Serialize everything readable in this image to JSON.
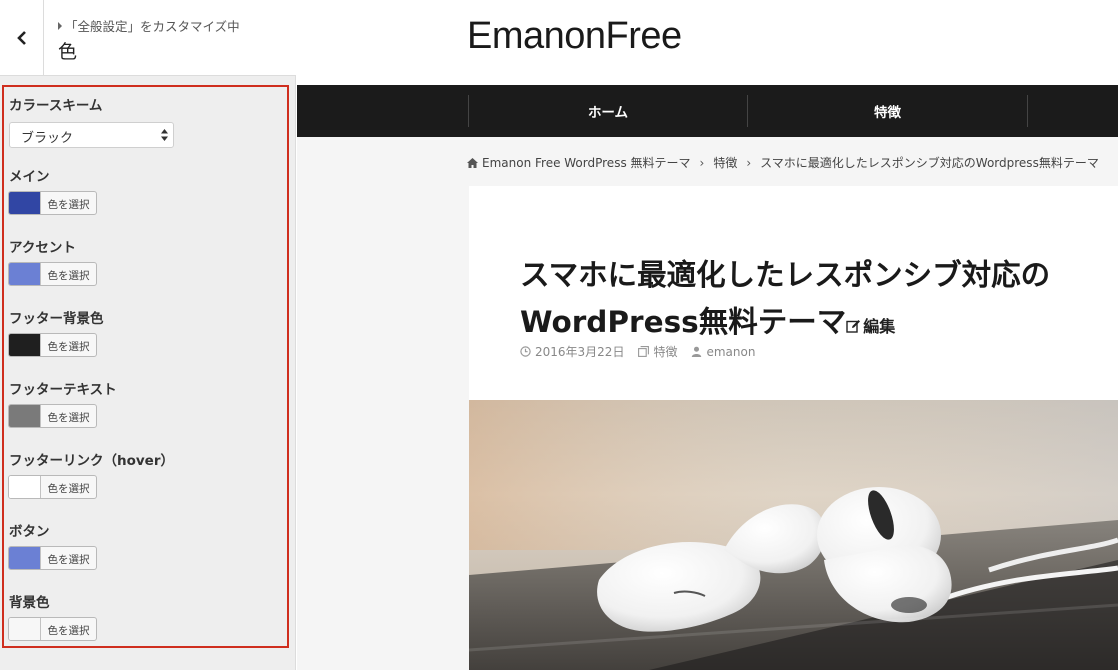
{
  "customizer": {
    "breadcrumb": "「全般設定」をカスタマイズ中",
    "title": "色",
    "scheme": {
      "label": "カラースキーム",
      "selected": "ブラック"
    },
    "picker_button_label": "色を選択",
    "colors": [
      {
        "label": "メイン",
        "color": "#3146a4"
      },
      {
        "label": "アクセント",
        "color": "#6b80d4"
      },
      {
        "label": "フッター背景色",
        "color": "#1f1f1f"
      },
      {
        "label": "フッターテキスト",
        "color": "#7a7a7a"
      },
      {
        "label": "フッターリンク（hover）",
        "color": "#ffffff"
      },
      {
        "label": "ボタン",
        "color": "#6b80d4"
      },
      {
        "label": "背景色",
        "color": "#f7f7f7"
      }
    ]
  },
  "preview": {
    "logo": "EmanonFree",
    "nav": [
      "ホーム",
      "特徴"
    ],
    "breadcrumb": [
      "Emanon Free WordPress 無料テーマ",
      "特徴",
      "スマホに最適化したレスポンシブ対応のWordpress無料テーマ"
    ],
    "article": {
      "title_line1": "スマホに最適化したレスポンシブ対応の",
      "title_line2": "WordPress無料テーマ",
      "edit_label": "編集",
      "date": "2016年3月22日",
      "category": "特徴",
      "author": "emanon"
    }
  }
}
